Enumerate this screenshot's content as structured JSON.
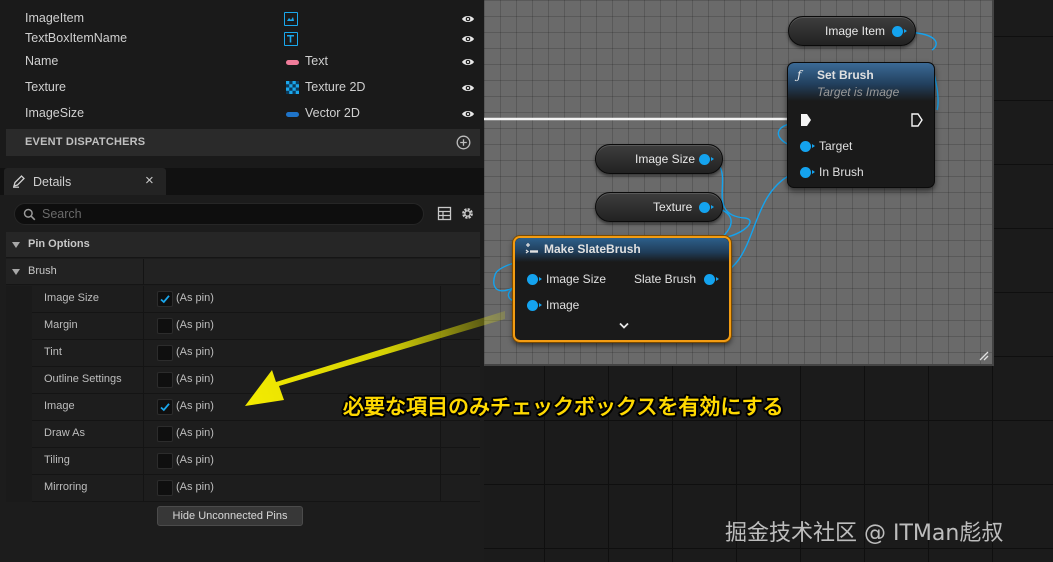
{
  "variables": {
    "rows": [
      {
        "name": "ImageItem",
        "type": "",
        "icon": "image-widget-icon"
      },
      {
        "name": "TextBoxItemName",
        "type": "",
        "icon": "text-widget-icon"
      },
      {
        "name": "Name",
        "type": "Text",
        "icon": "text-type-pill-icon"
      },
      {
        "name": "Texture",
        "type": "Texture 2D",
        "icon": "texture-checker-icon"
      },
      {
        "name": "ImageSize",
        "type": "Vector 2D",
        "icon": "vector-type-pill-icon"
      }
    ]
  },
  "event_dispatchers": {
    "label": "EVENT DISPATCHERS"
  },
  "details": {
    "tab_label": "Details",
    "close_glyph": "×",
    "search_placeholder": "Search",
    "categories": {
      "pin_options": "Pin Options",
      "brush": "Brush"
    },
    "pin_label": "(As pin)",
    "properties": [
      {
        "name": "Image Size",
        "checked": true
      },
      {
        "name": "Margin",
        "checked": false
      },
      {
        "name": "Tint",
        "checked": false
      },
      {
        "name": "Outline Settings",
        "checked": false
      },
      {
        "name": "Image",
        "checked": true
      },
      {
        "name": "Draw As",
        "checked": false
      },
      {
        "name": "Tiling",
        "checked": false
      },
      {
        "name": "Mirroring",
        "checked": false
      }
    ],
    "hide_button": "Hide Unconnected Pins"
  },
  "graph": {
    "image_item_node": "Image Item",
    "image_size_node": "Image Size",
    "texture_node": "Texture",
    "set_brush": {
      "title": "Set Brush",
      "subtitle": "Target is Image",
      "target_pin": "Target",
      "in_brush_pin": "In Brush"
    },
    "make_slatebrush": {
      "title": "Make SlateBrush",
      "image_size_pin": "Image Size",
      "image_pin": "Image",
      "output_pin": "Slate Brush"
    }
  },
  "annotation": "必要な項目のみチェックボックスを有効にする",
  "watermark": "掘金技术社区 @ ITMan彪叔",
  "colors": {
    "accent": "#14a3ef",
    "annotation": "#ffd900",
    "selection": "#f39c12",
    "pink_pill": "#f07c9a"
  }
}
